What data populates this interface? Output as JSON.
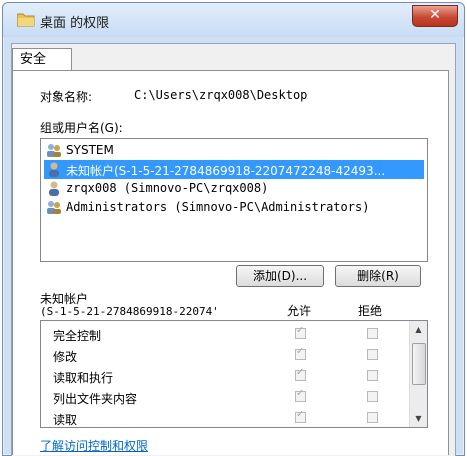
{
  "window": {
    "title": "桌面 的权限",
    "close_label": "✕"
  },
  "tabs": [
    {
      "label": "安全"
    }
  ],
  "object": {
    "label": "对象名称:",
    "value": "C:\\Users\\zrqx008\\Desktop"
  },
  "groups": {
    "label": "组或用户名(G):",
    "items": [
      {
        "name": "SYSTEM",
        "icon": "group-icon",
        "selected": false
      },
      {
        "name": "未知帐户(S-1-5-21-2784869918-2207472248-42493...",
        "icon": "user-icon",
        "selected": true
      },
      {
        "name": "zrqx008 (Simnovo-PC\\zrqx008)",
        "icon": "user-icon",
        "selected": false
      },
      {
        "name": "Administrators (Simnovo-PC\\Administrators)",
        "icon": "group-icon",
        "selected": false
      }
    ]
  },
  "buttons": {
    "add": "添加(D)...",
    "remove": "删除(R)"
  },
  "permissions": {
    "subject_line1": "未知帐户",
    "subject_line2": "(S-1-5-21-2784869918-22074'",
    "allow_header": "允许",
    "deny_header": "拒绝",
    "rows": [
      {
        "label": "完全控制",
        "allow": true,
        "deny": false
      },
      {
        "label": "修改",
        "allow": true,
        "deny": false
      },
      {
        "label": "读取和执行",
        "allow": true,
        "deny": false
      },
      {
        "label": "列出文件夹内容",
        "allow": true,
        "deny": false
      },
      {
        "label": "读取",
        "allow": true,
        "deny": false
      }
    ]
  },
  "link": "了解访问控制和权限"
}
